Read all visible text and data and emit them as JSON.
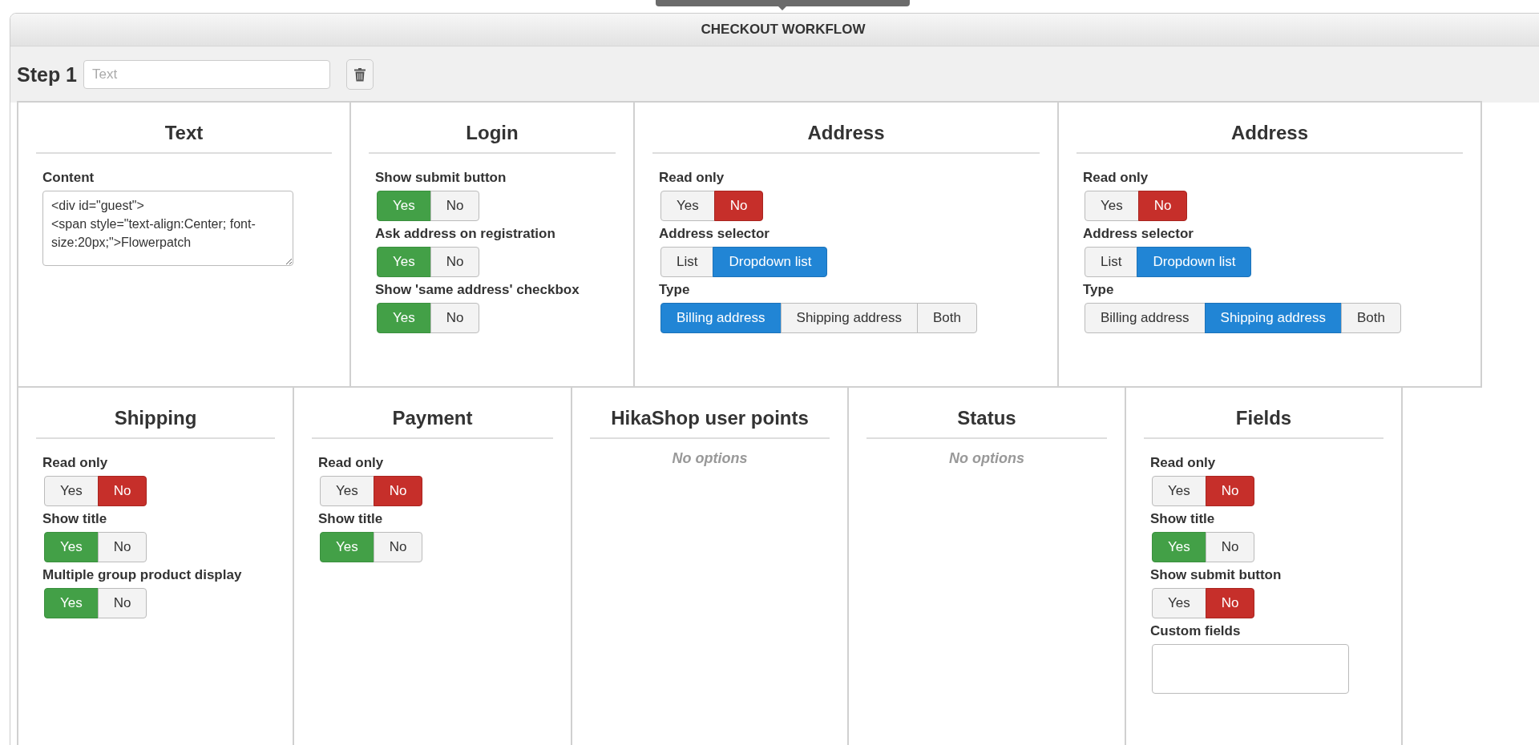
{
  "panel": {
    "title": "CHECKOUT WORKFLOW"
  },
  "step": {
    "label": "Step 1",
    "placeholder": "Text"
  },
  "rows": [
    [
      {
        "title": "Text",
        "settings": [
          {
            "kind": "textarea",
            "label": "Content",
            "value": "<div id=\"guest\">\n<span style=\"text-align:Center; font-size:20px;\">Flowerpatch"
          }
        ]
      },
      {
        "title": "Login",
        "settings": [
          {
            "kind": "yesno",
            "label": "Show submit button",
            "options": [
              {
                "label": "Yes",
                "selected": true
              },
              {
                "label": "No",
                "selected": false
              }
            ]
          },
          {
            "kind": "yesno",
            "label": "Ask address on registration",
            "options": [
              {
                "label": "Yes",
                "selected": true
              },
              {
                "label": "No",
                "selected": false
              }
            ]
          },
          {
            "kind": "yesno",
            "label": "Show 'same address' checkbox",
            "options": [
              {
                "label": "Yes",
                "selected": true
              },
              {
                "label": "No",
                "selected": false
              }
            ]
          }
        ]
      },
      {
        "title": "Address",
        "settings": [
          {
            "kind": "yesno",
            "label": "Read only",
            "options": [
              {
                "label": "Yes",
                "selected": false
              },
              {
                "label": "No",
                "selected": true
              }
            ]
          },
          {
            "kind": "choice",
            "label": "Address selector",
            "options": [
              {
                "label": "List",
                "selected": false
              },
              {
                "label": "Dropdown list",
                "selected": true
              }
            ]
          },
          {
            "kind": "choice",
            "label": "Type",
            "options": [
              {
                "label": "Billing address",
                "selected": true
              },
              {
                "label": "Shipping address",
                "selected": false
              },
              {
                "label": "Both",
                "selected": false
              }
            ]
          }
        ]
      },
      {
        "title": "Address",
        "settings": [
          {
            "kind": "yesno",
            "label": "Read only",
            "options": [
              {
                "label": "Yes",
                "selected": false
              },
              {
                "label": "No",
                "selected": true
              }
            ]
          },
          {
            "kind": "choice",
            "label": "Address selector",
            "options": [
              {
                "label": "List",
                "selected": false
              },
              {
                "label": "Dropdown list",
                "selected": true
              }
            ]
          },
          {
            "kind": "choice",
            "label": "Type",
            "options": [
              {
                "label": "Billing address",
                "selected": false
              },
              {
                "label": "Shipping address",
                "selected": true
              },
              {
                "label": "Both",
                "selected": false
              }
            ]
          }
        ]
      }
    ],
    [
      {
        "title": "Shipping",
        "settings": [
          {
            "kind": "yesno",
            "label": "Read only",
            "options": [
              {
                "label": "Yes",
                "selected": false
              },
              {
                "label": "No",
                "selected": true
              }
            ]
          },
          {
            "kind": "yesno",
            "label": "Show title",
            "options": [
              {
                "label": "Yes",
                "selected": true
              },
              {
                "label": "No",
                "selected": false
              }
            ]
          },
          {
            "kind": "yesno",
            "label": "Multiple group product display",
            "options": [
              {
                "label": "Yes",
                "selected": true
              },
              {
                "label": "No",
                "selected": false
              }
            ]
          }
        ]
      },
      {
        "title": "Payment",
        "settings": [
          {
            "kind": "yesno",
            "label": "Read only",
            "options": [
              {
                "label": "Yes",
                "selected": false
              },
              {
                "label": "No",
                "selected": true
              }
            ]
          },
          {
            "kind": "yesno",
            "label": "Show title",
            "options": [
              {
                "label": "Yes",
                "selected": true
              },
              {
                "label": "No",
                "selected": false
              }
            ]
          }
        ]
      },
      {
        "title": "HikaShop user points",
        "settings": [
          {
            "kind": "empty",
            "label": "No options"
          }
        ]
      },
      {
        "title": "Status",
        "settings": [
          {
            "kind": "empty",
            "label": "No options"
          }
        ]
      },
      {
        "title": "Fields",
        "settings": [
          {
            "kind": "yesno",
            "label": "Read only",
            "options": [
              {
                "label": "Yes",
                "selected": false
              },
              {
                "label": "No",
                "selected": true
              }
            ]
          },
          {
            "kind": "yesno",
            "label": "Show title",
            "options": [
              {
                "label": "Yes",
                "selected": true
              },
              {
                "label": "No",
                "selected": false
              }
            ]
          },
          {
            "kind": "yesno",
            "label": "Show submit button",
            "options": [
              {
                "label": "Yes",
                "selected": false
              },
              {
                "label": "No",
                "selected": true
              }
            ]
          },
          {
            "kind": "listbox",
            "label": "Custom fields"
          }
        ]
      }
    ]
  ]
}
